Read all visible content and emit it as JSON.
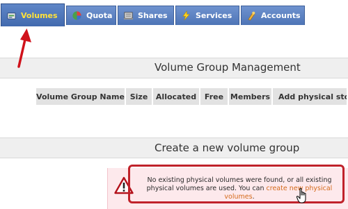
{
  "tabs": [
    {
      "label": "Volumes",
      "icon": "volumes-icon",
      "active": true
    },
    {
      "label": "Quota",
      "icon": "quota-pie-icon",
      "active": false
    },
    {
      "label": "Shares",
      "icon": "shares-icon",
      "active": false
    },
    {
      "label": "Services",
      "icon": "services-bolt-icon",
      "active": false
    },
    {
      "label": "Accounts",
      "icon": "accounts-icon",
      "active": false
    }
  ],
  "vg_management": {
    "title": "Volume Group Management",
    "columns": [
      "Volume Group Name",
      "Size",
      "Allocated",
      "Free",
      "Members",
      "Add physical sto"
    ]
  },
  "create_vg": {
    "title": "Create a new volume group",
    "warning_before": "No existing physical volumes were found, or all existing physical volumes are used. You can ",
    "warning_link": "create new physical volumes",
    "warning_after": "."
  },
  "colors": {
    "tab_bg": "#5b80c0",
    "active_tab_text": "#ffe23a",
    "annotation_red": "#c0222a",
    "link": "#d46a1a"
  }
}
